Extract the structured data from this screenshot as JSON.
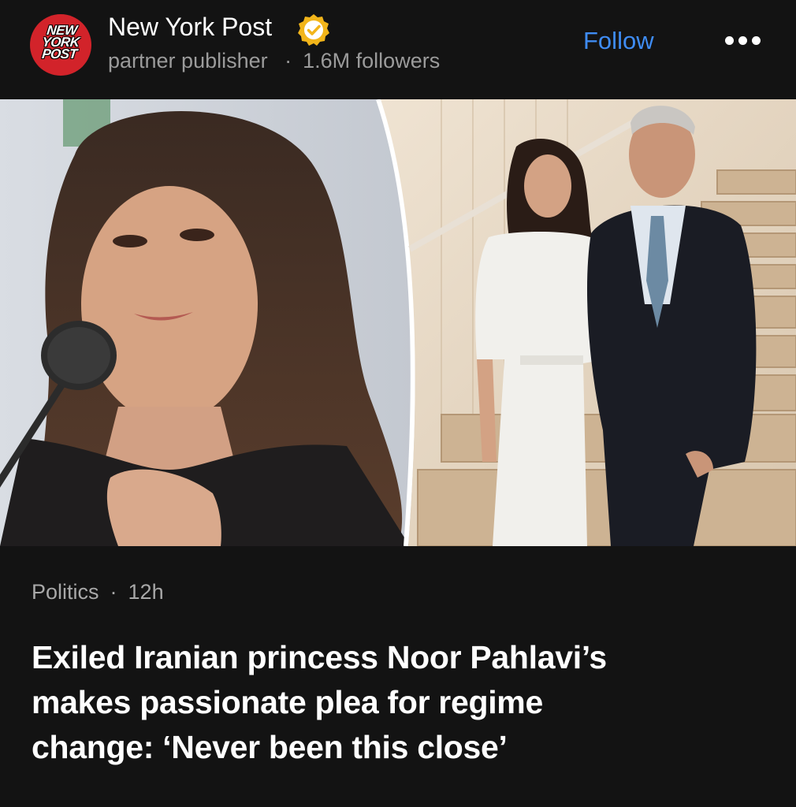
{
  "publisher": {
    "logo_text": [
      "NEW",
      "YORK",
      "POST"
    ],
    "name": "New York Post",
    "verified_icon": "verified-badge-icon",
    "badge_color": "#f2b51a",
    "type": "partner publisher",
    "followers": "1.6M followers",
    "follow_label": "Follow",
    "more_icon": "more-options-icon"
  },
  "article": {
    "category": "Politics",
    "age": "12h",
    "headline_lines": [
      "Exiled Iranian princess Noor Pahlavi’s",
      "makes passionate plea for regime",
      "change: ‘Never been this close’"
    ]
  },
  "colors": {
    "background": "#131313",
    "accent": "#3f8cf3",
    "logo_red": "#d2232a"
  }
}
